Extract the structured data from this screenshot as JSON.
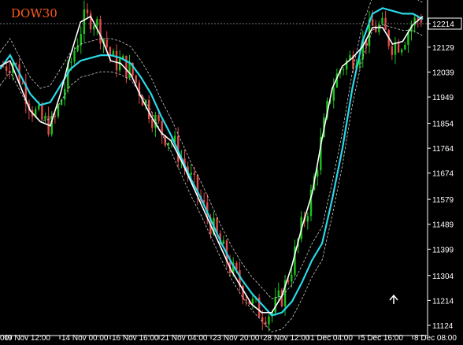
{
  "chart_data": {
    "type": "candlestick",
    "title": "DOW30",
    "ylim": [
      11124,
      12274
    ],
    "current_price": "12214",
    "y_ticks": [
      "12214",
      "12129",
      "12039",
      "11949",
      "11854",
      "11764",
      "11674",
      "11579",
      "11489",
      "11399",
      "11304",
      "11214",
      "11124"
    ],
    "x_ticks": [
      "9 Nov 12:00",
      "14 Nov 00:00",
      "16 Nov 16:00",
      "21 Nov 04:00",
      "23 Nov 20:00",
      "28 Nov 12:00",
      "1 Dec 04:00",
      "5 Dec 16:00",
      "8 Dec 08:00"
    ],
    "x_tick_first_partial": "00",
    "moving_average_white": [
      12060,
      12080,
      11990,
      11900,
      11860,
      11845,
      11960,
      12100,
      12220,
      12240,
      12170,
      12080,
      12070,
      12030,
      11950,
      11880,
      11820,
      11790,
      11720,
      11640,
      11560,
      11480,
      11400,
      11320,
      11260,
      11200,
      11170,
      11170,
      11230,
      11340,
      11480,
      11600,
      11800,
      11980,
      12060,
      12090,
      12130,
      12200,
      12200,
      12140,
      12150,
      12210,
      12240
    ],
    "moving_average_cyan": [
      12050,
      12100,
      12030,
      11960,
      11920,
      11930,
      11990,
      12050,
      12080,
      12090,
      12100,
      12100,
      12090,
      12070,
      12020,
      11960,
      11880,
      11810,
      11730,
      11650,
      11580,
      11500,
      11420,
      11350,
      11290,
      11240,
      11200,
      11160,
      11170,
      11210,
      11280,
      11360,
      11420,
      11580,
      11760,
      11980,
      12150,
      12250,
      12270,
      12260,
      12250,
      12250,
      12230
    ],
    "bull_color": "#1ec21e",
    "bear_color": "#e14b4b",
    "cyan_color": "#2ad8e8",
    "white_color": "#ffffff",
    "grid": false,
    "arrow_icon": "up-arrow-icon"
  }
}
